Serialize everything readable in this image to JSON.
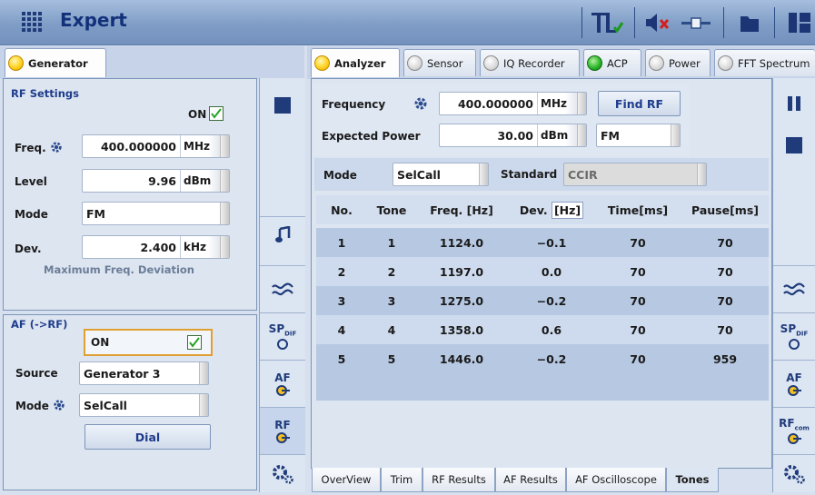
{
  "app": {
    "title": "Expert"
  },
  "generator": {
    "tab_label": "Generator",
    "rf_settings_title": "RF Settings",
    "rf_on_label": "ON",
    "freq_label": "Freq.",
    "freq_value": "400.000000",
    "freq_unit": "MHz",
    "level_label": "Level",
    "level_value": "9.96",
    "level_unit": "dBm",
    "mode_label": "Mode",
    "mode_value": "FM",
    "dev_label": "Dev.",
    "dev_value": "2.400",
    "dev_unit": "kHz",
    "max_dev_caption": "Maximum Freq. Deviation",
    "af_title": "AF (->RF)",
    "af_on_label": "ON",
    "source_label": "Source",
    "source_value": "Generator 3",
    "af_mode_label": "Mode",
    "af_mode_value": "SelCall",
    "dial_label": "Dial"
  },
  "analyzer": {
    "tabs": [
      {
        "label": "Analyzer",
        "led": "yellow",
        "active": true
      },
      {
        "label": "Sensor",
        "led": "off"
      },
      {
        "label": "IQ Recorder",
        "led": "off"
      },
      {
        "label": "ACP",
        "led": "green"
      },
      {
        "label": "Power",
        "led": "off"
      },
      {
        "label": "FFT Spectrum",
        "led": "off"
      }
    ],
    "frequency_label": "Frequency",
    "frequency_value": "400.000000",
    "frequency_unit": "MHz",
    "find_rf_label": "Find RF",
    "expected_power_label": "Expected Power",
    "expected_power_value": "30.00",
    "expected_power_unit": "dBm",
    "demod_value": "FM",
    "mode_label": "Mode",
    "mode_value": "SelCall",
    "standard_label": "Standard",
    "standard_value": "CCIR",
    "table": {
      "headers": [
        "No.",
        "Tone",
        "Freq. [Hz]",
        "Dev.",
        "[Hz]",
        "Time[ms]",
        "Pause[ms]"
      ],
      "rows": [
        [
          "1",
          "1",
          "1124.0",
          "−0.1",
          "70",
          "70"
        ],
        [
          "2",
          "2",
          "1197.0",
          "0.0",
          "70",
          "70"
        ],
        [
          "3",
          "3",
          "1275.0",
          "−0.2",
          "70",
          "70"
        ],
        [
          "4",
          "4",
          "1358.0",
          "0.6",
          "70",
          "70"
        ],
        [
          "5",
          "5",
          "1446.0",
          "−0.2",
          "70",
          "959"
        ]
      ]
    },
    "bottom_tabs": [
      "OverView",
      "Trim",
      "RF Results",
      "AF Results",
      "AF Oscilloscope",
      "Tones"
    ],
    "active_bottom_tab": "Tones"
  },
  "sidebar": {
    "sp_label": "SP",
    "sp_sub": "DIF",
    "af_label": "AF",
    "rf_label": "RF",
    "rf_com_sub": "com"
  },
  "colors": {
    "accent": "#1e3c8c",
    "title_bar": "#8aa6cf",
    "row_alt": "#b6c8e2"
  }
}
